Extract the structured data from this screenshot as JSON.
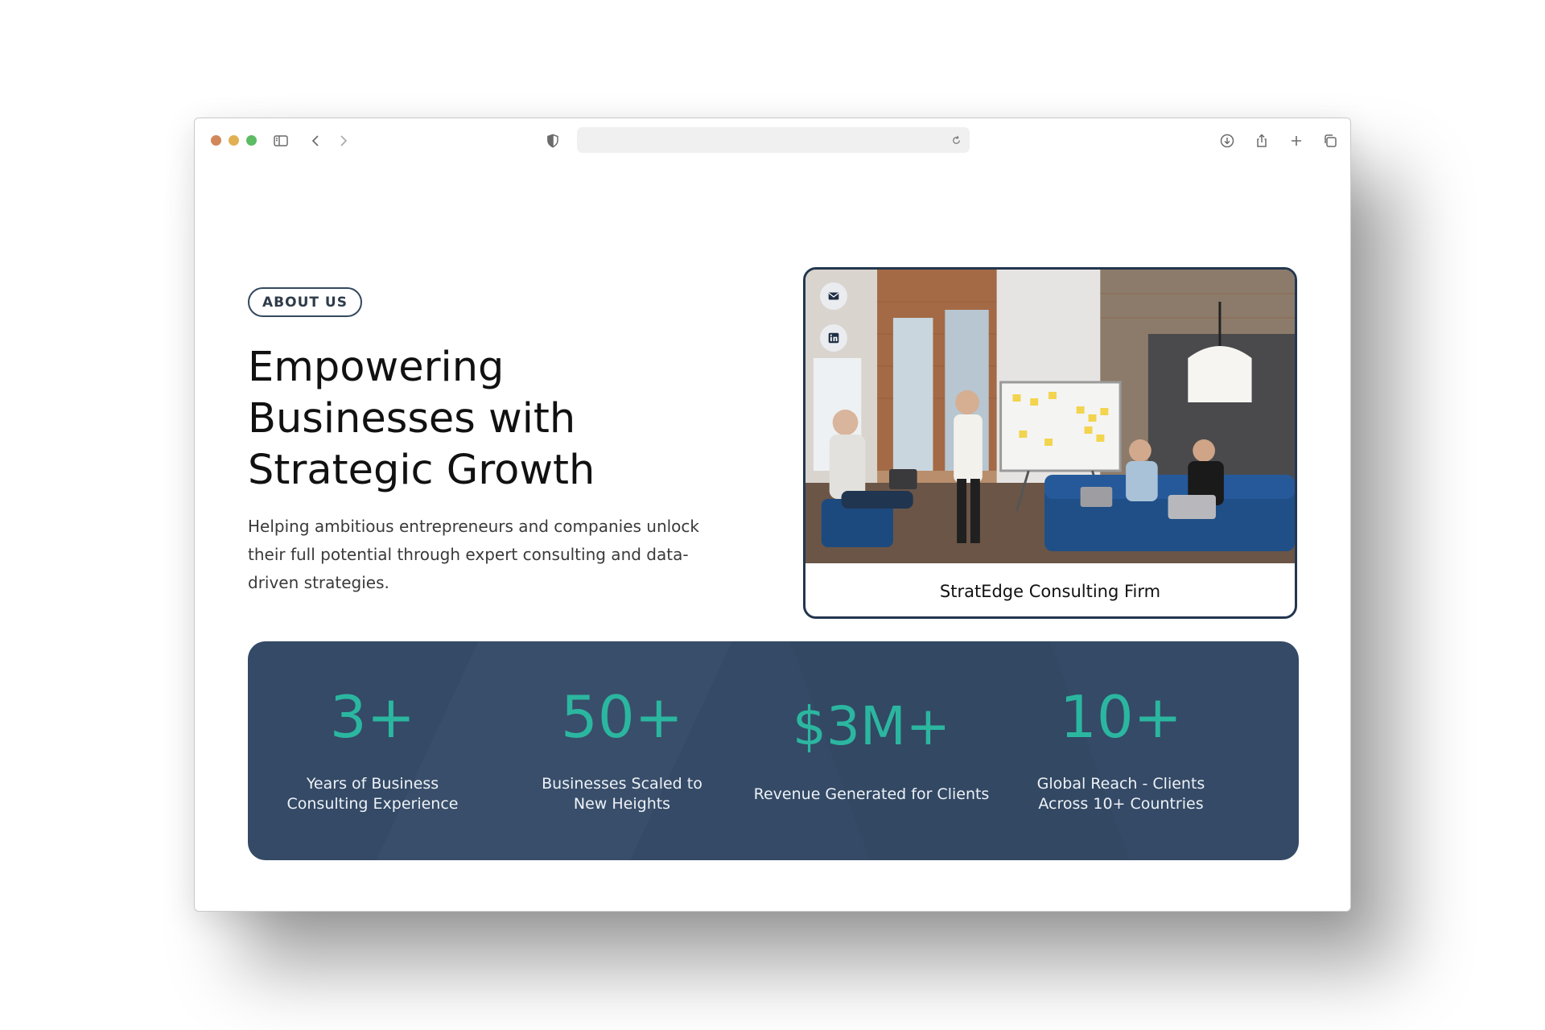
{
  "browser": {
    "url": "",
    "icons": {
      "sidebar": "sidebar-icon",
      "back": "chevron-left-icon",
      "forward": "chevron-right-icon",
      "privacy": "shield-icon",
      "reload": "reload-icon",
      "download": "download-icon",
      "share": "share-icon",
      "new_tab": "plus-icon",
      "tabs": "tabs-overview-icon"
    }
  },
  "hero": {
    "badge": "ABOUT US",
    "headline": "Empowering Businesses with Strategic Growth",
    "subtext": "Helping ambitious entrepreneurs and companies unlock their full potential through expert consulting and data-driven strategies."
  },
  "card": {
    "caption": "StratEdge Consulting Firm",
    "social_icons": [
      "mail-icon",
      "linkedin-icon"
    ]
  },
  "stats": [
    {
      "value": "3+",
      "label": "Years of Business Consulting Experience"
    },
    {
      "value": "50+",
      "label": "Businesses Scaled to New Heights"
    },
    {
      "value": "$3M+",
      "label": "Revenue Generated for Clients"
    },
    {
      "value": "10+",
      "label": "Global Reach - Clients Across 10+ Countries"
    }
  ],
  "colors": {
    "accent": "#2bb6a0",
    "panel": "#344a66",
    "border": "#23364f"
  }
}
